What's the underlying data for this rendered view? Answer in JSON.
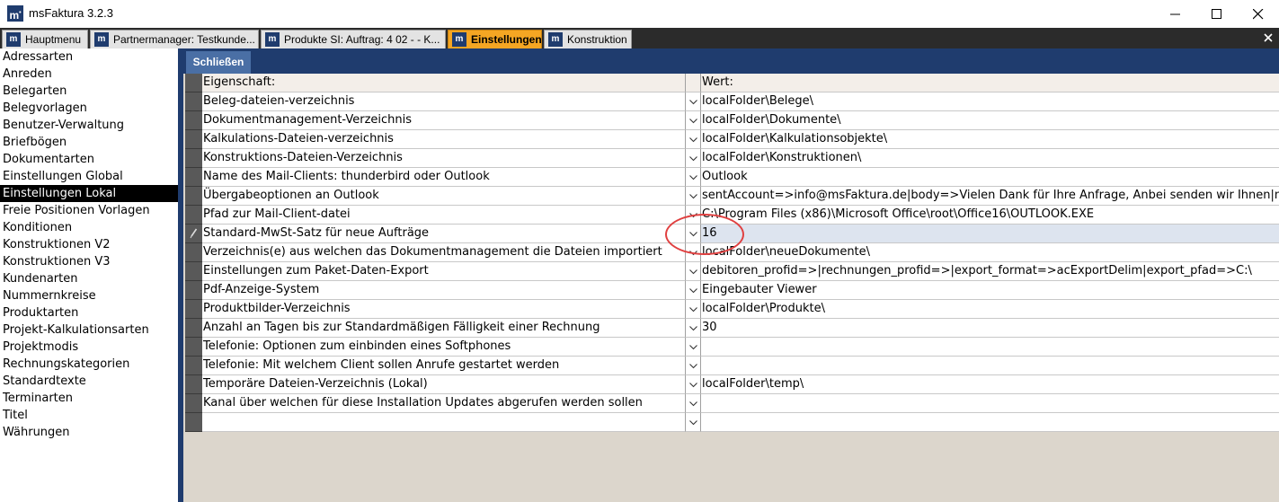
{
  "window": {
    "title": "msFaktura 3.2.3",
    "logo_text": "m"
  },
  "tabs": [
    {
      "label": "Hauptmenu",
      "active": false
    },
    {
      "label": "Partnermanager: Testkunde...",
      "active": false
    },
    {
      "label": "Produkte SI: Auftrag: 4 02 -  - K...",
      "active": false
    },
    {
      "label": "Einstellungen",
      "active": true
    },
    {
      "label": "Konstruktion",
      "active": false
    }
  ],
  "nav": {
    "selected_index": 8,
    "items": [
      "Adressarten",
      "Anreden",
      "Belegarten",
      "Belegvorlagen",
      "Benutzer-Verwaltung",
      "Briefbögen",
      "Dokumentarten",
      "Einstellungen Global",
      "Einstellungen Lokal",
      "Freie Positionen Vorlagen",
      "Konditionen",
      "Konstruktionen V2",
      "Konstruktionen V3",
      "Kundenarten",
      "Nummernkreise",
      "Produktarten",
      "Projekt-Kalkulationsarten",
      "Projektmodis",
      "Rechnungskategorien",
      "Standardtexte",
      "Terminarten",
      "Titel",
      "Währungen"
    ]
  },
  "toolbar": {
    "close_label": "Schließen"
  },
  "grid": {
    "header": {
      "property": "Eigenschaft:",
      "value": "Wert:"
    },
    "current_row": 7,
    "rows": [
      {
        "property": "Beleg-dateien-verzeichnis",
        "value": "localFolder\\Belege\\"
      },
      {
        "property": "Dokumentmanagement-Verzeichnis",
        "value": "localFolder\\Dokumente\\"
      },
      {
        "property": "Kalkulations-Dateien-verzeichnis",
        "value": "localFolder\\Kalkulationsobjekte\\"
      },
      {
        "property": "Konstruktions-Dateien-Verzeichnis",
        "value": "localFolder\\Konstruktionen\\"
      },
      {
        "property": "Name des Mail-Clients: thunderbird oder Outlook",
        "value": "Outlook"
      },
      {
        "property": "Übergabeoptionen an Outlook",
        "value": "sentAccount=>info@msFaktura.de|body=>Vielen Dank für Ihre Anfrage, Anbei senden wir Ihnen|maile"
      },
      {
        "property": "Pfad zur Mail-Client-datei",
        "value": "C:\\Program Files (x86)\\Microsoft Office\\root\\Office16\\OUTLOOK.EXE"
      },
      {
        "property": "Standard-MwSt-Satz für neue Aufträge",
        "value": "16"
      },
      {
        "property": "Verzeichnis(e) aus welchen das Dokumentmanagement die Dateien importiert",
        "value": "localFolder\\neueDokumente\\"
      },
      {
        "property": "Einstellungen zum Paket-Daten-Export",
        "value": "debitoren_profid=>|rechnungen_profid=>|export_format=>acExportDelim|export_pfad=>C:\\"
      },
      {
        "property": "Pdf-Anzeige-System",
        "value": "Eingebauter Viewer"
      },
      {
        "property": "Produktbilder-Verzeichnis",
        "value": "localFolder\\Produkte\\"
      },
      {
        "property": "Anzahl an Tagen bis zur Standardmäßigen Fälligkeit einer Rechnung",
        "value": "30"
      },
      {
        "property": "Telefonie: Optionen zum einbinden eines Softphones",
        "value": ""
      },
      {
        "property": "Telefonie: Mit welchem Client sollen Anrufe gestartet werden",
        "value": ""
      },
      {
        "property": "Temporäre Dateien-Verzeichnis (Lokal)",
        "value": "localFolder\\temp\\"
      },
      {
        "property": "Kanal über welchen für diese Installation Updates abgerufen werden sollen",
        "value": ""
      },
      {
        "property": "",
        "value": ""
      }
    ]
  },
  "colors": {
    "accent_navy": "#1f3c6e",
    "active_tab": "#f5a623",
    "annotation": "#e04040"
  }
}
